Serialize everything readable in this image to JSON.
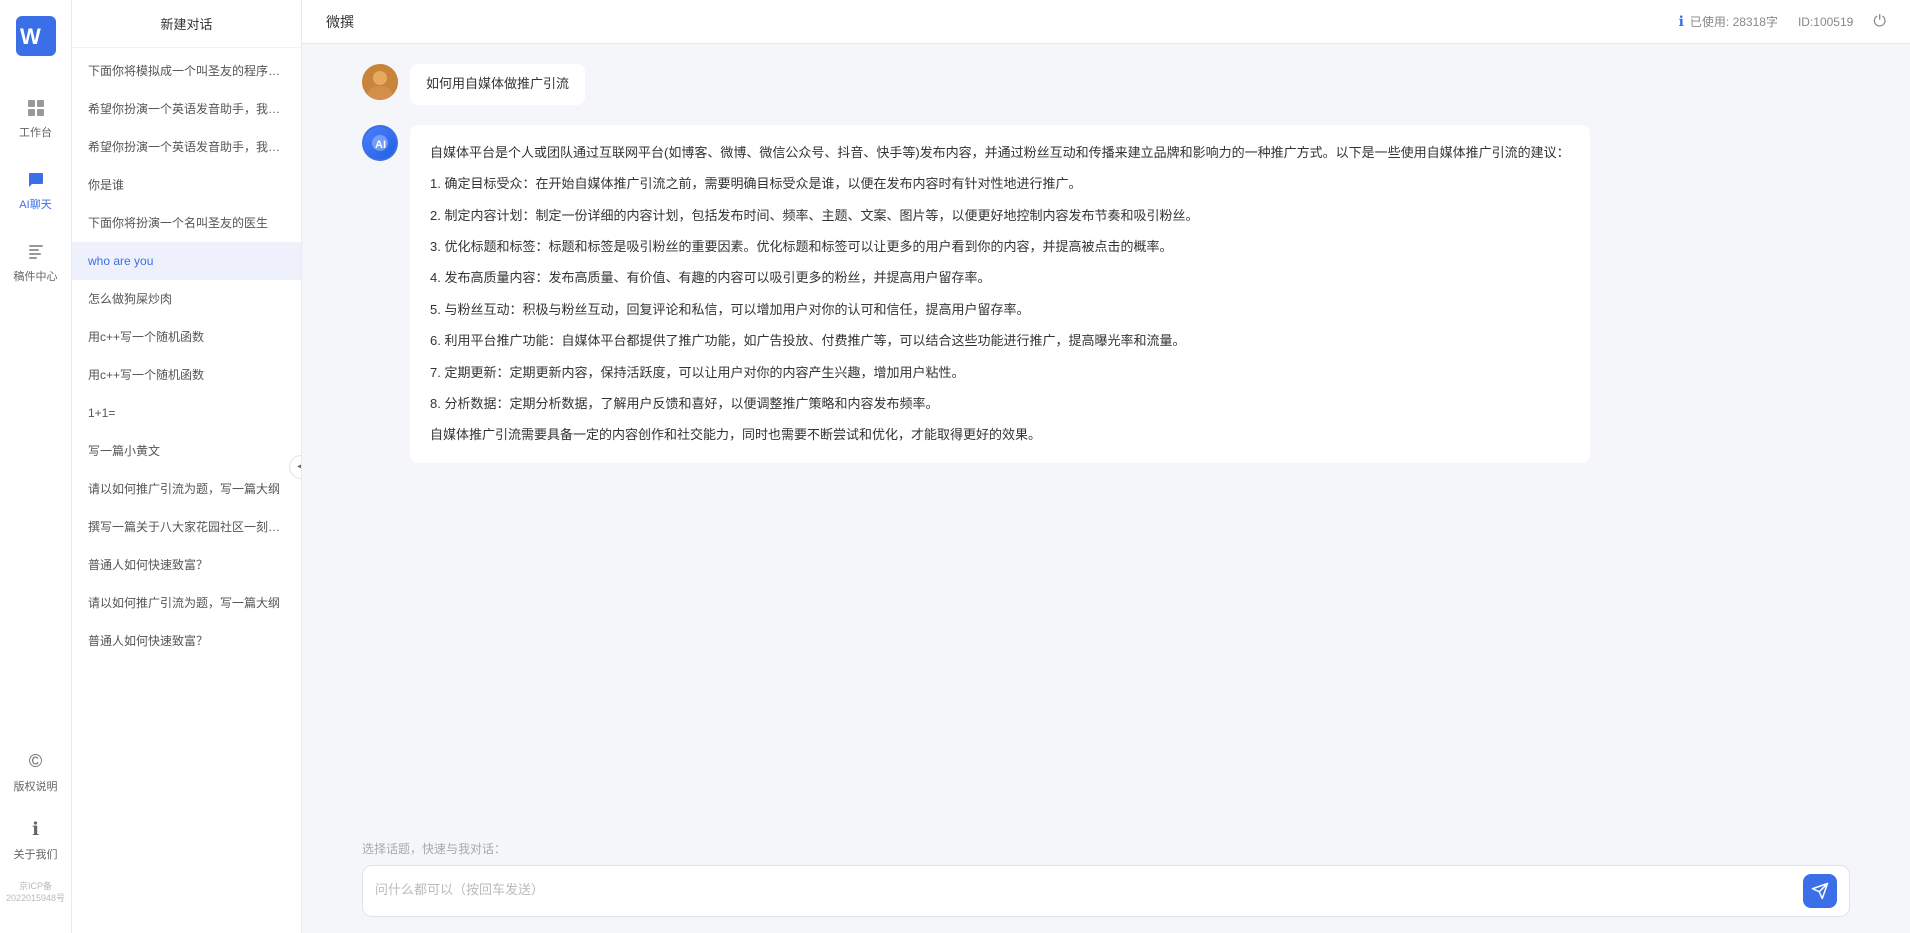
{
  "app": {
    "name": "微撰",
    "title": "微撰"
  },
  "header": {
    "title": "微撰",
    "usage_label": "已使用: 28318字",
    "user_id": "ID:100519",
    "usage_icon": "ℹ"
  },
  "nav": {
    "items": [
      {
        "id": "workbench",
        "label": "工作台",
        "icon": "⊞"
      },
      {
        "id": "ai-chat",
        "label": "AI聊天",
        "icon": "💬",
        "active": true
      },
      {
        "id": "components",
        "label": "稿件中心",
        "icon": "📄"
      }
    ],
    "bottom": [
      {
        "id": "copyright",
        "label": "版权说明",
        "icon": "©"
      },
      {
        "id": "about",
        "label": "关于我们",
        "icon": "ℹ"
      }
    ],
    "icp": "京ICP备2022015948号"
  },
  "history": {
    "new_chat_label": "新建对话",
    "items": [
      {
        "id": 1,
        "text": "下面你将模拟成一个叫圣友的程序员、我说..."
      },
      {
        "id": 2,
        "text": "希望你扮演一个英语发音助手，我提供给你..."
      },
      {
        "id": 3,
        "text": "希望你扮演一个英语发音助手，我提供给你..."
      },
      {
        "id": 4,
        "text": "你是谁"
      },
      {
        "id": 5,
        "text": "下面你将扮演一个名叫圣友的医生"
      },
      {
        "id": 6,
        "text": "who are you"
      },
      {
        "id": 7,
        "text": "怎么做狗屎炒肉"
      },
      {
        "id": 8,
        "text": "用c++写一个随机函数"
      },
      {
        "id": 9,
        "text": "用c++写一个随机函数"
      },
      {
        "id": 10,
        "text": "1+1="
      },
      {
        "id": 11,
        "text": "写一篇小黄文"
      },
      {
        "id": 12,
        "text": "请以如何推广引流为题，写一篇大纲"
      },
      {
        "id": 13,
        "text": "撰写一篇关于八大家花园社区一刻钟便民生..."
      },
      {
        "id": 14,
        "text": "普通人如何快速致富？"
      },
      {
        "id": 15,
        "text": "请以如何推广引流为题，写一篇大纲"
      },
      {
        "id": 16,
        "text": "普通人如何快速致富？"
      }
    ]
  },
  "chat": {
    "user_question": "如何用自媒体做推广引流",
    "ai_response_paragraphs": [
      "自媒体平台是个人或团队通过互联网平台(如博客、微博、微信公众号、抖音、快手等)发布内容，并通过粉丝互动和传播来建立品牌和影响力的一种推广方式。以下是一些使用自媒体推广引流的建议：",
      "1. 确定目标受众：在开始自媒体推广引流之前，需要明确目标受众是谁，以便在发布内容时有针对性地进行推广。",
      "2. 制定内容计划：制定一份详细的内容计划，包括发布时间、频率、主题、文案、图片等，以便更好地控制内容发布节奏和吸引粉丝。",
      "3. 优化标题和标签：标题和标签是吸引粉丝的重要因素。优化标题和标签可以让更多的用户看到你的内容，并提高被点击的概率。",
      "4. 发布高质量内容：发布高质量、有价值、有趣的内容可以吸引更多的粉丝，并提高用户留存率。",
      "5. 与粉丝互动：积极与粉丝互动，回复评论和私信，可以增加用户对你的认可和信任，提高用户留存率。",
      "6. 利用平台推广功能：自媒体平台都提供了推广功能，如广告投放、付费推广等，可以结合这些功能进行推广，提高曝光率和流量。",
      "7. 定期更新：定期更新内容，保持活跃度，可以让用户对你的内容产生兴趣，增加用户粘性。",
      "8. 分析数据：定期分析数据，了解用户反馈和喜好，以便调整推广策略和内容发布频率。",
      "自媒体推广引流需要具备一定的内容创作和社交能力，同时也需要不断尝试和优化，才能取得更好的效果。"
    ]
  },
  "input": {
    "quick_topics_label": "选择话题，快速与我对话：",
    "placeholder": "问什么都可以（按回车发送）"
  }
}
